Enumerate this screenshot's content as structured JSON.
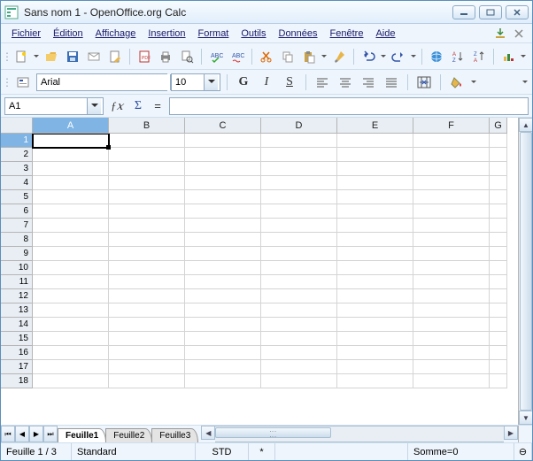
{
  "window": {
    "title": "Sans nom 1 - OpenOffice.org Calc"
  },
  "menu": {
    "items": [
      "Fichier",
      "Édition",
      "Affichage",
      "Insertion",
      "Format",
      "Outils",
      "Données",
      "Fenêtre",
      "Aide"
    ]
  },
  "format": {
    "font_name": "Arial",
    "font_size": "10",
    "bold": "G",
    "italic": "I",
    "underline": "S"
  },
  "namebox": {
    "cell_ref": "A1",
    "formula": ""
  },
  "columns": [
    "A",
    "B",
    "C",
    "D",
    "E",
    "F",
    "G"
  ],
  "rows": [
    "1",
    "2",
    "3",
    "4",
    "5",
    "6",
    "7",
    "8",
    "9",
    "10",
    "11",
    "12",
    "13",
    "14",
    "15",
    "16",
    "17",
    "18"
  ],
  "selected": {
    "col": "A",
    "row": "1"
  },
  "sheets": {
    "tabs": [
      "Feuille1",
      "Feuille2",
      "Feuille3"
    ],
    "active": 0
  },
  "status": {
    "sheet_pos": "Feuille 1 / 3",
    "style": "Standard",
    "mode": "STD",
    "marker": "*",
    "sum": "Somme=0"
  }
}
